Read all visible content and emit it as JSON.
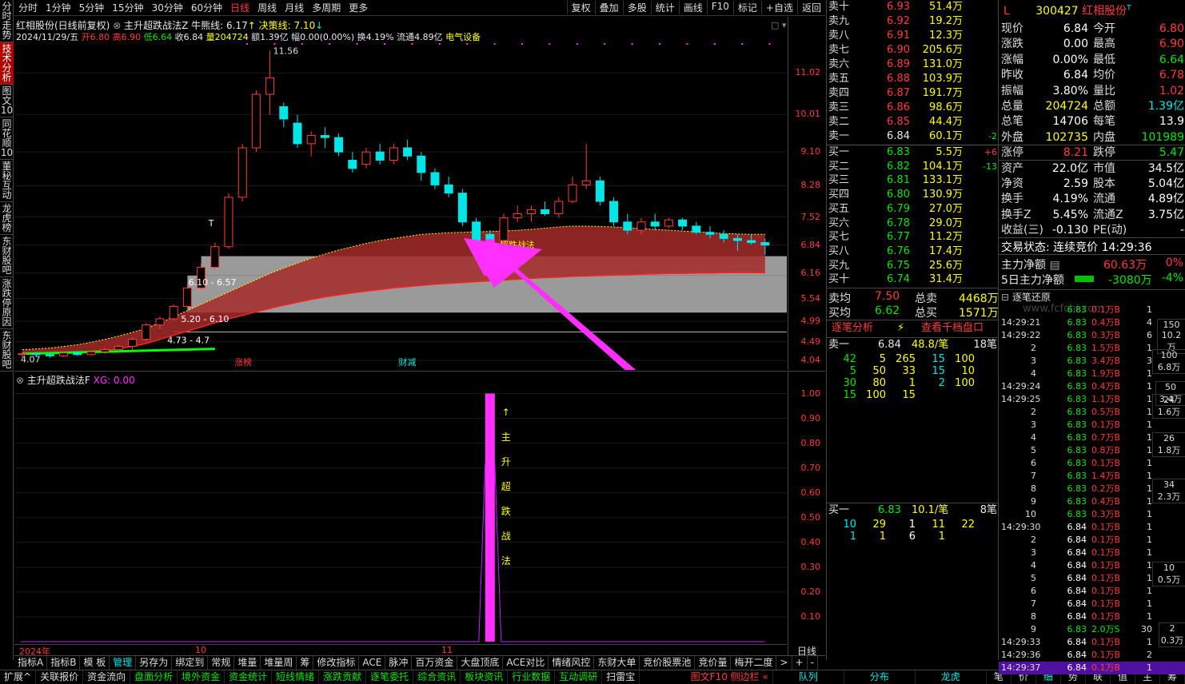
{
  "period_bar": {
    "items": [
      "分时",
      "1分钟",
      "5分钟",
      "15分钟",
      "30分钟",
      "60分钟",
      "日线",
      "周线",
      "月线",
      "多周期",
      "更多"
    ],
    "active": "日线",
    "right": [
      "复权",
      "叠加",
      "多股",
      "统计",
      "画线",
      "F10",
      "标记",
      "+自选",
      "返回"
    ]
  },
  "vtabs": [
    "分时走势",
    "技术分析",
    "图文10",
    "同花顺10",
    "董秘互动",
    "龙虎榜",
    "东财股吧",
    "涨跌停原因",
    "东财股吧"
  ],
  "header": {
    "title": "红相股份(日线前复权)",
    "indicator": "主升超跌战法Z",
    "bull_label": "牛熊线: 6.17",
    "decision_label": "决策线: 7.10",
    "date": "2024/11/29/五",
    "open": "开6.80",
    "high": "高6.90",
    "low": "低6.64",
    "close": "收6.84",
    "volume": "量204724",
    "amount": "额1.39亿",
    "amplitude": "幅0.00(0.00%)",
    "turnover": "换4.19%",
    "float": "流通4.89亿",
    "sector": "电气设备"
  },
  "chart_labels": {
    "high_mark": "11.56",
    "low_mark": "4.07",
    "zone1": "6.10 - 6.57",
    "zone2": "5.20 - 6.10",
    "zone3": "4.73 - 4.7",
    "signal": "超跌战法",
    "t_mark": "T",
    "tag_zhangbang": "涨榜",
    "tag_caijian": "财减"
  },
  "axis_main": [
    "11.02",
    "10.01",
    "9.10",
    "8.28",
    "7.52",
    "6.84",
    "6.16",
    "5.54",
    "4.99",
    "4.49",
    "4.04"
  ],
  "indicator_panel": {
    "title": "主升超跌战法F",
    "xg": "XG: 0.00",
    "text": [
      "↑",
      "主",
      "升",
      "超",
      "跌",
      "战",
      "法"
    ]
  },
  "axis_ind": [
    "1.00",
    "0.90",
    "0.80",
    "0.70",
    "0.60",
    "0.50",
    "0.40",
    "0.30",
    "0.20",
    "0.10"
  ],
  "dates": {
    "y": "2024年",
    "m10": "10",
    "m11": "11"
  },
  "day_label": "日线",
  "tabs1": [
    "指标A",
    "指标B",
    "模 板",
    "管理",
    "另存为",
    "绑定到",
    "常规",
    "堆量",
    "堆量周",
    "筹",
    "修改指标",
    "ACE",
    "脉冲",
    "百万资金",
    "大盘顶底",
    "ACE对比",
    "情绪风控",
    "东财大单",
    "竞价股票池",
    "竞价量",
    "梅开二度",
    ">",
    "+",
    "-"
  ],
  "tabs2": [
    "扩展^",
    "关联报价",
    "资金流向",
    "盘面分析",
    "境外资金",
    "资金统计",
    "短线情绪",
    "涨跌贡献",
    "逐笔委托",
    "综合资讯",
    "板块资讯",
    "行业数据",
    "互动调研",
    "扫雷宝"
  ],
  "tabs2_right": [
    "图文F10 侧边栏 «",
    "队列",
    "分布",
    "龙虎",
    "笔",
    "价",
    "细",
    "势",
    "联",
    "值",
    "主",
    "筹"
  ],
  "sell_book": [
    [
      "卖十",
      "6.93",
      "51.4万",
      ""
    ],
    [
      "卖九",
      "6.92",
      "19.2万",
      ""
    ],
    [
      "卖八",
      "6.91",
      "12.3万",
      ""
    ],
    [
      "卖七",
      "6.90",
      "205.6万",
      ""
    ],
    [
      "卖六",
      "6.89",
      "131.0万",
      ""
    ],
    [
      "卖五",
      "6.88",
      "103.9万",
      ""
    ],
    [
      "卖四",
      "6.87",
      "191.7万",
      ""
    ],
    [
      "卖三",
      "6.86",
      "98.6万",
      ""
    ],
    [
      "卖二",
      "6.85",
      "44.4万",
      ""
    ],
    [
      "卖一",
      "6.84",
      "60.1万",
      "-2"
    ]
  ],
  "buy_book": [
    [
      "买一",
      "6.83",
      "5.5万",
      "+6"
    ],
    [
      "买二",
      "6.82",
      "104.1万",
      "-13"
    ],
    [
      "买三",
      "6.81",
      "133.1万",
      ""
    ],
    [
      "买四",
      "6.80",
      "130.9万",
      ""
    ],
    [
      "买五",
      "6.79",
      "27.0万",
      ""
    ],
    [
      "买六",
      "6.78",
      "29.0万",
      ""
    ],
    [
      "买七",
      "6.77",
      "11.2万",
      ""
    ],
    [
      "买八",
      "6.76",
      "17.4万",
      ""
    ],
    [
      "买九",
      "6.75",
      "25.6万",
      ""
    ],
    [
      "买十",
      "6.74",
      "31.4万",
      ""
    ]
  ],
  "book_summary": {
    "sell_avg_label": "卖均",
    "sell_avg": "7.50",
    "sell_total_label": "总卖",
    "sell_total": "4468万",
    "buy_avg_label": "买均",
    "buy_avg": "6.62",
    "buy_total_label": "总买",
    "buy_total": "1571万"
  },
  "info": {
    "code": "300427",
    "name": "红相股份",
    "rows": [
      [
        "现价",
        "6.84",
        "今开",
        "6.80"
      ],
      [
        "涨跌",
        "0.00",
        "最高",
        "6.90"
      ],
      [
        "涨幅",
        "0.00%",
        "最低",
        "6.64"
      ],
      [
        "昨收",
        "6.84",
        "均价",
        "6.78"
      ],
      [
        "振幅",
        "3.80%",
        "量比",
        "1.02"
      ],
      [
        "总量",
        "204724",
        "总额",
        "1.39亿"
      ],
      [
        "总笔",
        "14706",
        "每笔",
        "13.9"
      ],
      [
        "外盘",
        "102735",
        "内盘",
        "101989"
      ],
      [
        "涨停",
        "8.21",
        "跌停",
        "5.47"
      ],
      [
        "资产",
        "22.0亿",
        "市值",
        "34.5亿"
      ],
      [
        "净资",
        "2.59",
        "股本",
        "5.04亿"
      ],
      [
        "换手",
        "4.19%",
        "流通",
        "4.89亿"
      ],
      [
        "换手Z",
        "5.45%",
        "流通Z",
        "3.75亿"
      ],
      [
        "收益(三)",
        "-0.130",
        "PE(动)",
        "-"
      ]
    ],
    "status": "交易状态: 连续竞价 14:29:36",
    "flow1_label": "主力净额",
    "flow1": "60.63万",
    "flow1_pct": "0%",
    "flow2_label": "5日主力净额",
    "flow2": "-3080万",
    "flow2_pct": "-4%"
  },
  "analysis": {
    "tab1": "逐笔分析",
    "tab2": "查看千档盘口",
    "sell1": {
      "label": "卖一",
      "price": "6.84",
      "avg": "48.8/笔",
      "count": "18笔",
      "rows": [
        [
          "42",
          "5",
          "265",
          "15",
          "100"
        ],
        [
          "5",
          "50",
          "33",
          "15",
          "10"
        ],
        [
          "30",
          "80",
          "1",
          "2",
          "100"
        ],
        [
          "15",
          "100",
          "15",
          "",
          ""
        ]
      ]
    },
    "buy1": {
      "label": "买一",
      "price": "6.83",
      "avg": "10.1/笔",
      "count": "8笔",
      "rows": [
        [
          "10",
          "29",
          "1",
          "11",
          "22"
        ],
        [
          "1",
          "1",
          "6",
          "1",
          ""
        ]
      ]
    }
  },
  "ticks_title": "逐笔还原",
  "ticks": [
    [
      "",
      "6.83",
      "0.1万B",
      "1"
    ],
    [
      "14:29:21",
      "6.83",
      "0.4万B",
      "4"
    ],
    [
      "14:29:22",
      "6.83",
      "0.3万B",
      "6"
    ],
    [
      "2",
      "6.83",
      "1.5万B",
      "1"
    ],
    [
      "3",
      "6.83",
      "3.4万B",
      "3"
    ],
    [
      "4",
      "6.83",
      "1.9万B",
      "1"
    ],
    [
      "14:29:24",
      "6.83",
      "0.4万B",
      "1"
    ],
    [
      "14:29:25",
      "6.83",
      "1.1万B",
      "1"
    ],
    [
      "2",
      "6.83",
      "0.5万B",
      "1"
    ],
    [
      "3",
      "6.83",
      "0.1万B",
      "1"
    ],
    [
      "4",
      "6.83",
      "0.7万B",
      "1"
    ],
    [
      "5",
      "6.83",
      "0.8万B",
      "1"
    ],
    [
      "6",
      "6.83",
      "0.1万B",
      "1"
    ],
    [
      "7",
      "6.83",
      "1.4万B",
      "1"
    ],
    [
      "8",
      "6.83",
      "0.2万B",
      "1"
    ],
    [
      "9",
      "6.83",
      "0.4万B",
      "1"
    ],
    [
      "10",
      "6.83",
      "0.3万B",
      "1"
    ],
    [
      "14:29:30",
      "6.84",
      "0.1万B",
      "1"
    ],
    [
      "2",
      "6.84",
      "0.1万B",
      "1"
    ],
    [
      "3",
      "6.84",
      "0.1万B",
      "1"
    ],
    [
      "4",
      "6.84",
      "0.1万B",
      "1"
    ],
    [
      "5",
      "6.84",
      "0.1万B",
      "1"
    ],
    [
      "6",
      "6.84",
      "0.1万B",
      "1"
    ],
    [
      "7",
      "6.84",
      "0.1万B",
      "1"
    ],
    [
      "8",
      "6.84",
      "0.1万B",
      "1"
    ],
    [
      "9",
      "6.83",
      "2.0万S",
      "30"
    ],
    [
      "14:29:33",
      "6.84",
      "0.1万B",
      "1"
    ],
    [
      "14:29:36",
      "6.84",
      "0.1万B",
      "2"
    ],
    [
      "14:29:37",
      "6.84",
      "0.1万B",
      "1"
    ]
  ],
  "tick_summary": [
    [
      "150",
      "10.2万"
    ],
    [
      "100",
      "6.8万"
    ],
    [
      "50",
      "3.4万"
    ],
    [
      "24",
      "1.6万"
    ],
    [
      "26",
      "1.8万"
    ],
    [
      "34",
      "2.3万"
    ],
    [
      "10",
      "0.5万"
    ],
    [
      "2",
      "0.3万"
    ]
  ],
  "watermark": "www.fcfchi.com",
  "chart_data": {
    "type": "candlestick",
    "candles": [
      [
        4.2,
        4.25,
        4.1,
        4.2
      ],
      [
        4.2,
        4.25,
        4.12,
        4.18
      ],
      [
        4.18,
        4.22,
        4.1,
        4.15
      ],
      [
        4.15,
        4.25,
        4.12,
        4.22
      ],
      [
        4.22,
        4.26,
        4.15,
        4.18
      ],
      [
        4.18,
        4.28,
        4.15,
        4.25
      ],
      [
        4.25,
        4.35,
        4.2,
        4.3
      ],
      [
        4.3,
        4.42,
        4.25,
        4.38
      ],
      [
        4.38,
        4.6,
        4.3,
        4.55
      ],
      [
        4.55,
        4.95,
        4.5,
        4.9
      ],
      [
        4.9,
        5.1,
        4.8,
        5.05
      ],
      [
        5.05,
        5.4,
        5.0,
        5.35
      ],
      [
        5.35,
        5.9,
        5.3,
        5.8
      ],
      [
        5.8,
        6.4,
        5.75,
        6.3
      ],
      [
        6.3,
        6.9,
        6.25,
        6.8
      ],
      [
        6.8,
        8.1,
        6.75,
        8.0
      ],
      [
        8.0,
        9.3,
        7.9,
        9.2
      ],
      [
        9.2,
        10.6,
        9.1,
        10.5
      ],
      [
        10.5,
        11.56,
        10.0,
        10.9
      ],
      [
        10.2,
        10.3,
        9.7,
        9.9
      ],
      [
        9.8,
        10.0,
        9.2,
        9.3
      ],
      [
        9.3,
        9.6,
        9.0,
        9.5
      ],
      [
        9.5,
        9.7,
        9.2,
        9.45
      ],
      [
        9.45,
        9.55,
        9.0,
        9.1
      ],
      [
        8.9,
        9.1,
        8.6,
        8.7
      ],
      [
        8.8,
        9.2,
        8.7,
        9.1
      ],
      [
        9.1,
        9.3,
        8.8,
        8.9
      ],
      [
        8.9,
        9.3,
        8.8,
        9.2
      ],
      [
        9.2,
        9.4,
        8.9,
        9.0
      ],
      [
        9.0,
        9.1,
        8.4,
        8.6
      ],
      [
        8.6,
        8.7,
        8.2,
        8.3
      ],
      [
        8.3,
        8.5,
        8.0,
        8.1
      ],
      [
        8.1,
        8.2,
        7.3,
        7.4
      ],
      [
        7.4,
        7.5,
        6.8,
        6.9
      ],
      [
        7.1,
        7.2,
        6.85,
        6.95
      ],
      [
        6.95,
        7.6,
        6.9,
        7.5
      ],
      [
        7.5,
        7.8,
        7.4,
        7.6
      ],
      [
        7.6,
        7.8,
        7.4,
        7.7
      ],
      [
        7.7,
        7.9,
        7.55,
        7.6
      ],
      [
        7.6,
        8.0,
        7.5,
        7.9
      ],
      [
        7.9,
        8.5,
        7.85,
        8.3
      ],
      [
        8.3,
        9.3,
        8.2,
        8.4
      ],
      [
        8.4,
        8.5,
        7.8,
        7.9
      ],
      [
        7.9,
        8.0,
        7.3,
        7.4
      ],
      [
        7.4,
        7.6,
        7.1,
        7.2
      ],
      [
        7.2,
        7.5,
        7.1,
        7.4
      ],
      [
        7.4,
        7.6,
        7.2,
        7.3
      ],
      [
        7.3,
        7.5,
        7.25,
        7.45
      ],
      [
        7.45,
        7.5,
        7.2,
        7.3
      ],
      [
        7.3,
        7.4,
        7.1,
        7.15
      ],
      [
        7.15,
        7.3,
        7.0,
        7.1
      ],
      [
        7.1,
        7.2,
        6.9,
        7.0
      ],
      [
        7.0,
        7.1,
        6.7,
        6.95
      ],
      [
        6.95,
        7.1,
        6.85,
        6.9
      ],
      [
        6.9,
        7.0,
        6.6,
        6.84
      ]
    ],
    "band_top": [
      4.3,
      4.32,
      4.34,
      4.38,
      4.42,
      4.48,
      4.55,
      4.63,
      4.72,
      4.82,
      4.95,
      5.1,
      5.25,
      5.4,
      5.55,
      5.7,
      5.85,
      6.0,
      6.15,
      6.28,
      6.4,
      6.52,
      6.62,
      6.72,
      6.8,
      6.88,
      6.95,
      7.0,
      7.05,
      7.1,
      7.12,
      7.14,
      7.15,
      7.16,
      7.17,
      7.18,
      7.2,
      7.22,
      7.25,
      7.28,
      7.3,
      7.3,
      7.29,
      7.28,
      7.26,
      7.24,
      7.22,
      7.2,
      7.18,
      7.16,
      7.14,
      7.12,
      7.11,
      7.1,
      7.1
    ],
    "band_bottom": [
      4.2,
      4.21,
      4.22,
      4.23,
      4.24,
      4.26,
      4.28,
      4.32,
      4.38,
      4.45,
      4.55,
      4.65,
      4.75,
      4.85,
      4.95,
      5.05,
      5.13,
      5.22,
      5.3,
      5.38,
      5.45,
      5.52,
      5.58,
      5.63,
      5.68,
      5.72,
      5.76,
      5.8,
      5.83,
      5.86,
      5.89,
      5.91,
      5.93,
      5.95,
      5.97,
      5.99,
      6.01,
      6.03,
      6.05,
      6.06,
      6.08,
      6.09,
      6.1,
      6.11,
      6.12,
      6.13,
      6.14,
      6.15,
      6.15,
      6.16,
      6.16,
      6.17,
      6.17,
      6.17,
      6.17
    ],
    "ylim": [
      4.04,
      11.8
    ],
    "signal_index": 34,
    "ind_values": {
      "pulse_index": 34,
      "pulse_value": 1.0
    },
    "ind_ylim": [
      0,
      1.05
    ]
  },
  "colors": {
    "up": "#ff3c3c",
    "down": "#00e5e5",
    "band": "#a52a2a",
    "accent": "#ff30ff"
  }
}
